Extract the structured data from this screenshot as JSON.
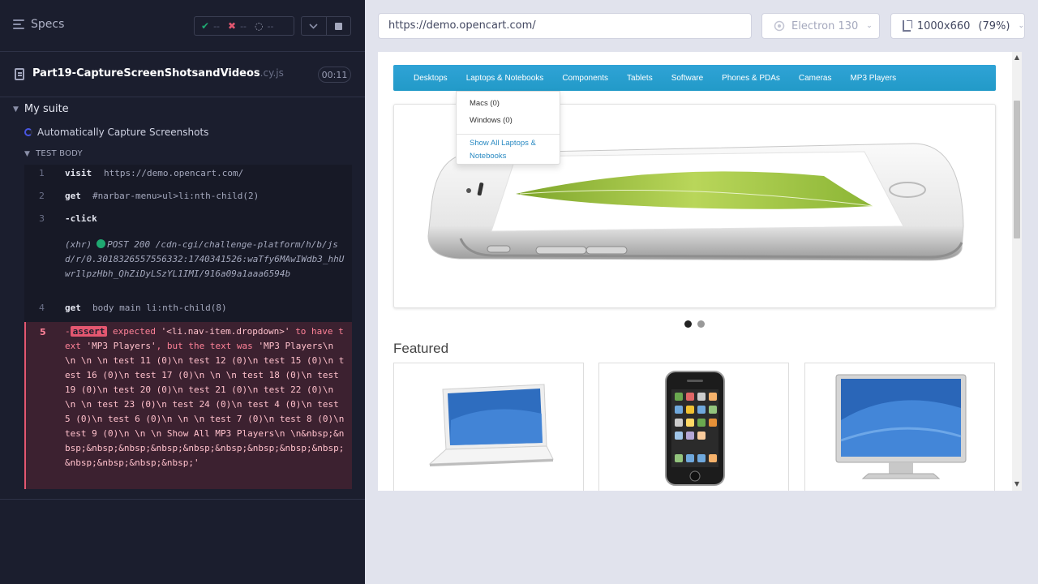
{
  "reporter": {
    "header": {
      "specs_label": "Specs",
      "stats": {
        "passed": "--",
        "failed": "--",
        "pending": "--"
      }
    },
    "spec": {
      "name": "Part19-CaptureScreenShotsandVideos",
      "ext": ".cy.js",
      "duration": "00:11"
    },
    "suite_title": "My suite",
    "test_title": "Automatically Capture Screenshots",
    "body_label": "TEST BODY",
    "commands": [
      {
        "num": "1",
        "name": "visit",
        "message": "https://demo.opencart.com/"
      },
      {
        "num": "2",
        "name": "get",
        "message": "#narbar-menu>ul>li:nth-child(2)"
      },
      {
        "num": "3",
        "name": "-click",
        "message": ""
      },
      {
        "num": "4",
        "name": "get",
        "message": "body main li:nth-child(8)"
      }
    ],
    "xhr": {
      "label": "(xhr)",
      "method_status": "POST 200",
      "url": "/cdn-cgi/challenge-platform/h/b/jsd/r/0.3018326557556332:1740341526:waTfy6MAwIWdb3_hhUwr1lpzHbh_QhZiDyLSzYL1IMI/916a09a1aaa6594b"
    },
    "failed": {
      "num": "5",
      "prefix": "-",
      "badge": "assert",
      "expected_word": "expected",
      "selector": "'<li.nav-item.dropdown>'",
      "to_have_text": "to have text",
      "expected_text": "'MP3 Players'",
      "but_was": ", but the text was",
      "actual_text": "'MP3 Players\\n \\n \\n \\n test 11 (0)\\n test 12 (0)\\n test 15 (0)\\n test 16 (0)\\n test 17 (0)\\n \\n \\n test 18 (0)\\n test 19 (0)\\n test 20 (0)\\n test 21 (0)\\n test 22 (0)\\n \\n \\n test 23 (0)\\n test 24 (0)\\n test 4 (0)\\n test 5 (0)\\n test 6 (0)\\n \\n \\n test 7 (0)\\n test 8 (0)\\n test 9 (0)\\n \\n \\n Show All MP3 Players\\n \\n&nbsp;&nbsp;&nbsp;&nbsp;&nbsp;&nbsp;&nbsp;&nbsp;&nbsp;&nbsp;&nbsp;&nbsp;&nbsp;&nbsp;'"
    }
  },
  "aut": {
    "url": "https://demo.opencart.com/",
    "browser": "Electron 130",
    "viewport": "1000x660",
    "zoom": "(79%)"
  },
  "site": {
    "nav": [
      "Desktops",
      "Laptops & Notebooks",
      "Components",
      "Tablets",
      "Software",
      "Phones & PDAs",
      "Cameras",
      "MP3 Players"
    ],
    "dropdown": {
      "items": [
        "Macs (0)",
        "Windows (0)"
      ],
      "show_all": "Show All Laptops & Notebooks"
    },
    "slides_total": 2,
    "slide_active": 1,
    "featured_heading": "Featured"
  },
  "colors": {
    "reporter_bg": "#1b1e2e",
    "pass": "#1fa971",
    "fail": "#e45770",
    "navbar": "#229ac8",
    "aut_bg": "#e1e3ed"
  },
  "icons": {
    "specs_toggle": "hamburger-icon",
    "file": "file-icon",
    "pass": "check-icon",
    "fail": "x-icon",
    "pending": "spinner-icon"
  }
}
